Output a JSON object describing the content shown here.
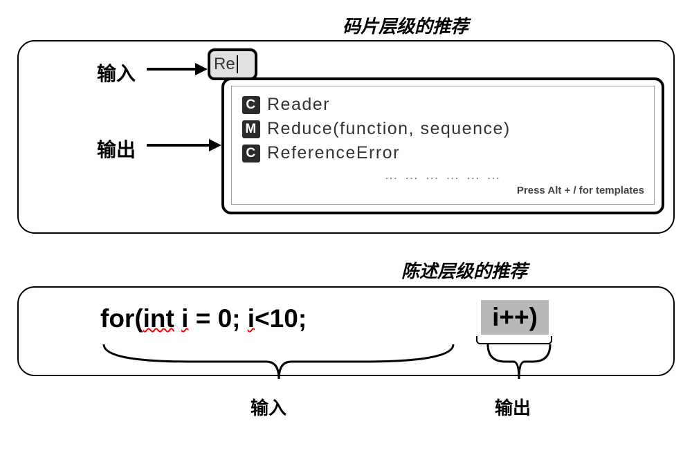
{
  "titles": {
    "section1": "码片层级的推荐",
    "section2": "陈述层级的推荐"
  },
  "labels": {
    "input": "输入",
    "output": "输出"
  },
  "section1": {
    "input_text": "Re",
    "popup": {
      "items": [
        {
          "icon": "C",
          "label": "Reader"
        },
        {
          "icon": "M",
          "label": "Reduce(function, sequence)"
        },
        {
          "icon": "C",
          "label": "ReferenceError"
        }
      ],
      "dots": "… …   … …   … …",
      "footer": "Press Alt + / for templates"
    }
  },
  "section2": {
    "code_prefix": "for(",
    "code_int": "int",
    "code_mid1": " ",
    "code_i1": "i",
    "code_eq": " = 0; ",
    "code_i2": "i",
    "code_lt": "<10; ",
    "output_suggestion": "i++)"
  }
}
